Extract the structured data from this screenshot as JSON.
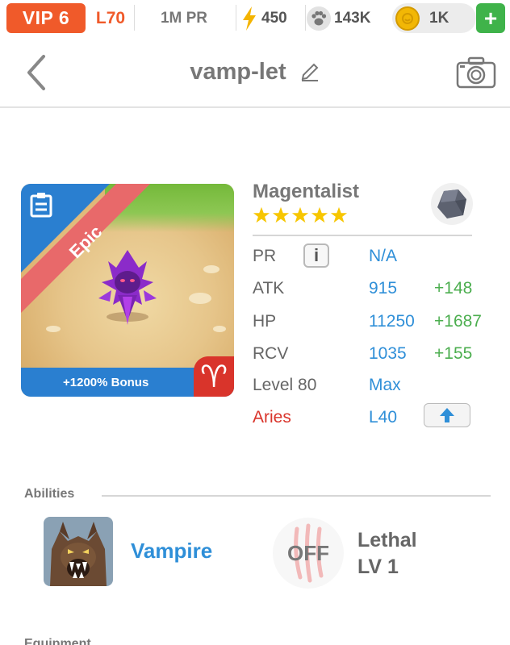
{
  "topbar": {
    "vip": "VIP 6",
    "level": "L70",
    "pr": "1M PR",
    "energy": "450",
    "paw": "143K",
    "coins": "1K",
    "add": "+"
  },
  "nav": {
    "title": "vamp-let"
  },
  "monster": {
    "rarity": "Epic",
    "bonus": "+1200% Bonus",
    "sign_glyph": "♈",
    "name": "Magentalist",
    "stars": 5
  },
  "stats": {
    "pr_label": "PR",
    "pr_info": "i",
    "pr_value": "N/A",
    "atk_label": "ATK",
    "atk_value": "915",
    "atk_bonus": "+148",
    "hp_label": "HP",
    "hp_value": "11250",
    "hp_bonus": "+1687",
    "rcv_label": "RCV",
    "rcv_value": "1035",
    "rcv_bonus": "+155",
    "level_label": "Level 80",
    "level_value": "Max",
    "sign_label": "Aries",
    "sign_value": "L40"
  },
  "abilities": {
    "section_title": "Abilities",
    "ability_name": "Vampire",
    "off_label": "OFF",
    "secondary_name": "Lethal",
    "secondary_level": "LV 1"
  },
  "equipment": {
    "section_title": "Equipment"
  },
  "colors": {
    "vip": "#f05a2a",
    "blue": "#2f8fd8",
    "green": "#4cae4f",
    "red": "#d9342b",
    "epic_ribbon": "#e8696a"
  }
}
